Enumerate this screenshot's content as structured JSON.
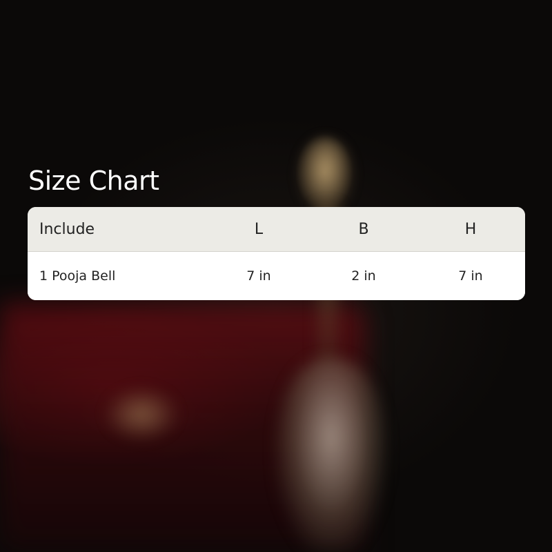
{
  "title": "Size Chart",
  "table": {
    "headers": [
      "Include",
      "L",
      "B",
      "H"
    ],
    "rows": [
      [
        "1 Pooja Bell",
        "7 in",
        "2 in",
        "7 in"
      ]
    ]
  },
  "colors": {
    "header_bg": "#ecebe6",
    "row_bg": "#ffffff",
    "title_text": "#ffffff",
    "table_text": "#222222"
  }
}
